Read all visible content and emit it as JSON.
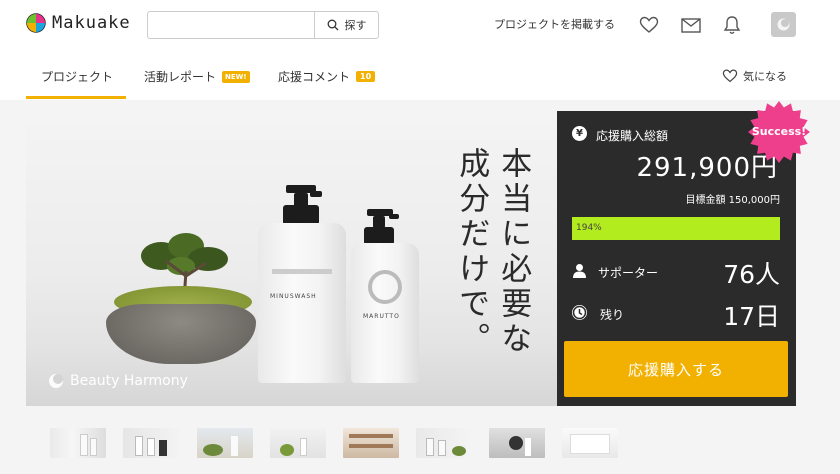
{
  "header": {
    "logo_text": "Makuake",
    "search_placeholder": "",
    "search_button": "探す",
    "post_project_link": "プロジェクトを掲載する"
  },
  "tabs": [
    {
      "label": "プロジェクト",
      "active": true
    },
    {
      "label": "活動レポート",
      "badge": "NEW!"
    },
    {
      "label": "応援コメント",
      "badge": "10"
    }
  ],
  "favorite_label": "気になる",
  "hero": {
    "headline_col1": "本当に必要な",
    "headline_col2": "成分だけで。",
    "brand": "Beauty Harmony",
    "bottle1_label": "MINUSWASH",
    "bottle2_label": "MARUTTO"
  },
  "stats": {
    "success_badge": "Success!",
    "total_label": "応援購入総額",
    "total_amount": "291,900円",
    "target_label": "目標金額",
    "target_amount": "150,000円",
    "progress_text": "194%",
    "progress_fraction": 1.0,
    "supporters_label": "サポーター",
    "supporters_value": "76人",
    "remaining_label": "残り",
    "remaining_value": "17日",
    "buy_button": "応援購入する"
  },
  "colors": {
    "accent": "#f2b100",
    "panel_bg": "#2b2b2b",
    "progress": "#b2eb1e",
    "success": "#ee3f8c"
  },
  "thumbnails": [
    "thumb-1",
    "thumb-2",
    "thumb-3",
    "thumb-4",
    "thumb-5",
    "thumb-6",
    "thumb-7",
    "thumb-8"
  ]
}
